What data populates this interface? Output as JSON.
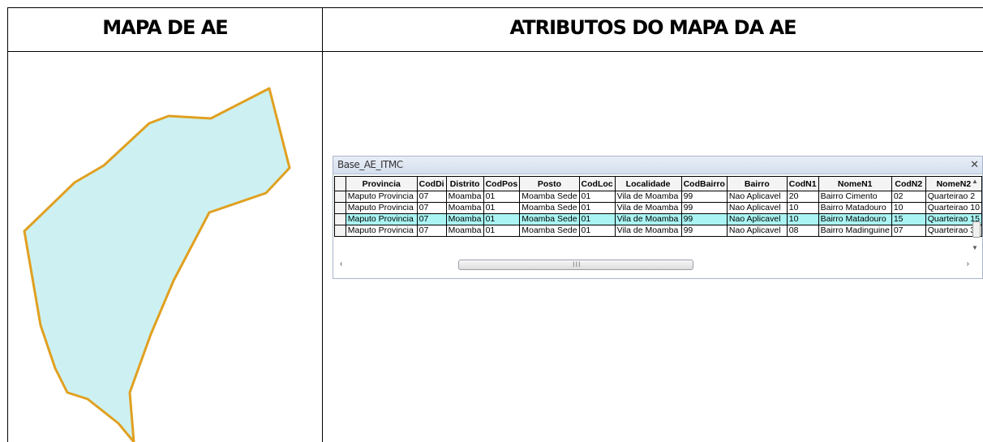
{
  "headers": {
    "left": "MAPA DE AE",
    "right": "ATRIBUTOS DO MAPA DA AE"
  },
  "colors": {
    "polygon_fill": "#cdf1f2",
    "polygon_stroke": "#e0a020",
    "row_highlight": "#aaf5f3"
  },
  "window": {
    "title": "Base_AE_ITMC",
    "close_icon": "close-icon"
  },
  "table": {
    "columns": [
      "Provincia",
      "CodDi",
      "Distrito",
      "CodPos",
      "Posto",
      "CodLoc",
      "Localidade",
      "CodBairro",
      "Bairro",
      "CodN1",
      "NomeN1",
      "CodN2",
      "NomeN2"
    ],
    "rows": [
      [
        "Maputo Provincia",
        "07",
        "Moamba",
        "01",
        "Moamba Sede",
        "01",
        "Vila de Moamba",
        "99",
        "Nao Aplicavel",
        "20",
        "Bairro Cimento",
        "02",
        "Quarteirao 2"
      ],
      [
        "Maputo Provincia",
        "07",
        "Moamba",
        "01",
        "Moamba Sede",
        "01",
        "Vila de Moamba",
        "99",
        "Nao Aplicavel",
        "10",
        "Bairro Matadouro",
        "10",
        "Quarteirao 10"
      ],
      [
        "Maputo Provincia",
        "07",
        "Moamba",
        "01",
        "Moamba Sede",
        "01",
        "Vila de Moamba",
        "99",
        "Nao Aplicavel",
        "10",
        "Bairro Matadouro",
        "15",
        "Quarteirao 15"
      ],
      [
        "Maputo Provincia",
        "07",
        "Moamba",
        "01",
        "Moamba Sede",
        "01",
        "Vila de Moamba",
        "99",
        "Nao Aplicavel",
        "08",
        "Bairro Madinguine",
        "07",
        "Quarteirao 3"
      ]
    ],
    "highlighted_row": 2
  },
  "scroll": {
    "left_arrow": "‹",
    "right_arrow": "›",
    "up_arrow": "▲",
    "down_arrow": "▼",
    "grip": "III"
  }
}
